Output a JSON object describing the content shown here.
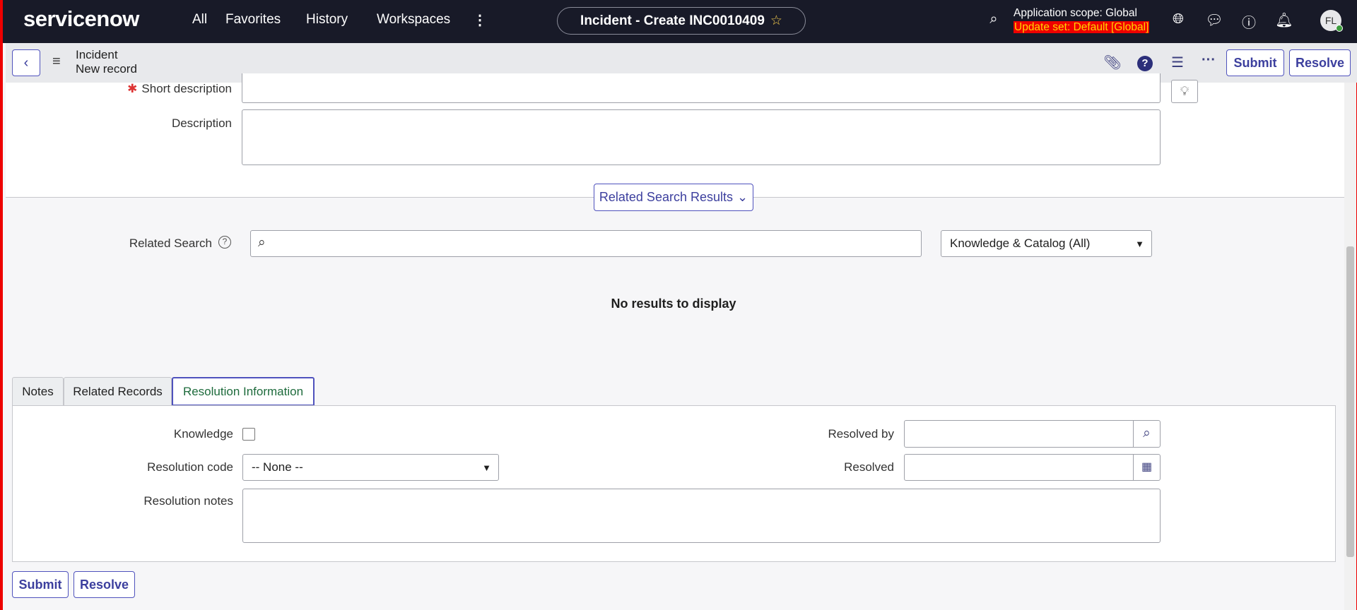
{
  "header": {
    "logo": "servicenow",
    "nav": [
      "All",
      "Favorites",
      "History",
      "Workspaces"
    ],
    "title": "Incident - Create INC0010409",
    "scope": "Application scope: Global",
    "update_set": "Update set: Default [Global]",
    "avatar": "FL"
  },
  "subheader": {
    "title": "Incident",
    "subtitle": "New record",
    "submit": "Submit",
    "resolve": "Resolve"
  },
  "form": {
    "short_description_label": "Short description",
    "short_description_value": "",
    "description_label": "Description",
    "description_value": ""
  },
  "related": {
    "button": "Related Search Results",
    "search_label": "Related Search",
    "search_value": "",
    "source_select": "Knowledge & Catalog (All)",
    "empty": "No results to display"
  },
  "tabs": [
    {
      "label": "Notes"
    },
    {
      "label": "Related Records"
    },
    {
      "label": "Resolution Information",
      "active": true
    }
  ],
  "resolution": {
    "knowledge_label": "Knowledge",
    "knowledge_checked": false,
    "code_label": "Resolution code",
    "code_value": "-- None --",
    "notes_label": "Resolution notes",
    "resolved_by_label": "Resolved by",
    "resolved_by_value": "",
    "resolved_label": "Resolved",
    "resolved_value": ""
  },
  "footer": {
    "submit": "Submit",
    "resolve": "Resolve"
  },
  "colors": {
    "topbar": "#181a28",
    "accent": "#4f52bd",
    "update_set_bg": "#ee0000",
    "update_set_text": "#ffd400",
    "active_tab_text": "#1e6b3c"
  }
}
